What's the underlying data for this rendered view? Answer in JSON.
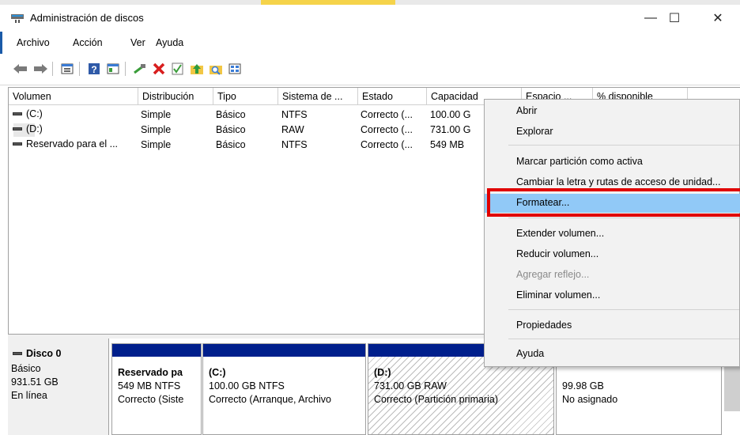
{
  "window": {
    "title": "Administración de discos",
    "controls": {
      "minimize": "—",
      "maximize": "☐",
      "close": "✕"
    }
  },
  "menubar": [
    "Archivo",
    "Acción",
    "Ver",
    "Ayuda"
  ],
  "toolbar_icons": [
    "back-arrow-icon",
    "forward-arrow-icon",
    "disk-list-icon",
    "help-icon",
    "properties-icon",
    "connect-icon",
    "delete-icon",
    "check-icon",
    "up-folder-icon",
    "search-folder-icon",
    "view-icon"
  ],
  "list": {
    "columns": [
      "Volumen",
      "Distribución",
      "Tipo",
      "Sistema de ...",
      "Estado",
      "Capacidad",
      "Espacio ...",
      "% disponible"
    ],
    "rows": [
      {
        "volume": "(C:)",
        "layout": "Simple",
        "type": "Básico",
        "fs": "NTFS",
        "status": "Correcto (...",
        "capacity": "100.00 G"
      },
      {
        "volume": "(D:)",
        "layout": "Simple",
        "type": "Básico",
        "fs": "RAW",
        "status": "Correcto (...",
        "capacity": "731.00 G"
      },
      {
        "volume": "Reservado para el ...",
        "layout": "Simple",
        "type": "Básico",
        "fs": "NTFS",
        "status": "Correcto (...",
        "capacity": "549 MB"
      }
    ]
  },
  "disk": {
    "name": "Disco 0",
    "kind": "Básico",
    "size": "931.51 GB",
    "state": "En línea",
    "partitions": [
      {
        "name": "Reservado pa",
        "detail": "549 MB NTFS",
        "status": "Correcto (Siste"
      },
      {
        "name": "(C:)",
        "detail": "100.00 GB NTFS",
        "status": "Correcto (Arranque, Archivo"
      },
      {
        "name": "(D:)",
        "detail": "731.00 GB RAW",
        "status": "Correcto (Partición primaria)"
      },
      {
        "name": "",
        "detail": "99.98 GB",
        "status": "No asignado"
      }
    ]
  },
  "context_menu": {
    "items": [
      {
        "label": "Abrir",
        "enabled": true
      },
      {
        "label": "Explorar",
        "enabled": true
      },
      {
        "label": "Marcar partición como activa",
        "enabled": true
      },
      {
        "label": "Cambiar la letra y rutas de acceso de unidad...",
        "enabled": true
      },
      {
        "label": "Formatear...",
        "enabled": true,
        "highlighted": true
      },
      {
        "label": "Extender volumen...",
        "enabled": true
      },
      {
        "label": "Reducir volumen...",
        "enabled": true
      },
      {
        "label": "Agregar reflejo...",
        "enabled": false
      },
      {
        "label": "Eliminar volumen...",
        "enabled": true
      },
      {
        "label": "Propiedades",
        "enabled": true
      },
      {
        "label": "Ayuda",
        "enabled": true
      }
    ]
  },
  "colors": {
    "partition_band": "#001f8c",
    "menu_highlight": "#91c9f7",
    "callout_border": "#e00000"
  }
}
